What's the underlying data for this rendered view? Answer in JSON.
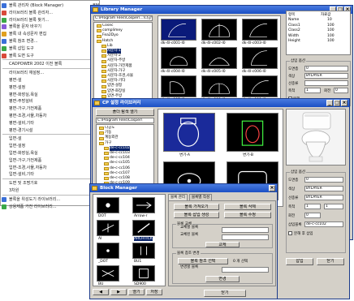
{
  "menu": {
    "items": [
      {
        "label": "블록 관리자 (Block Manager)",
        "shortcut": "BM",
        "icon": "block-icon",
        "color": "#3a6fd8"
      },
      {
        "label": "라이브러리 블록 관리자...",
        "shortcut": "LM",
        "icon": "library-icon",
        "color": "#d84a3a"
      },
      {
        "label": "라이브러리 블록 찾기...",
        "shortcut": "FB",
        "icon": "search-icon",
        "color": "#3aa848"
      },
      {
        "label": "블록을 문자 바꾸기",
        "shortcut": "BTM",
        "icon": "text-icon",
        "color": "#8a5ad8"
      },
      {
        "label": "블록 내 속성문자 편집",
        "shortcut": "",
        "icon": "edit-icon",
        "color": "#e0a020"
      },
      {
        "label": "블록 참조 변경...",
        "shortcut": "BRC",
        "icon": "swap-icon",
        "color": "#3a6fd8"
      },
      {
        "label": "블록 삽입 도구",
        "shortcut": "BMT",
        "icon": "insert-icon",
        "color": "#3aa848"
      },
      {
        "label": "블록 도면 도구",
        "shortcut": "",
        "icon": "tool-icon",
        "color": "#d84a3a"
      },
      {
        "label": "CADPOWER 2002 이전 블록",
        "shortcut": "",
        "icon": "",
        "color": ""
      },
      {
        "label": "라이브러리 재설정...",
        "shortcut": "",
        "icon": "",
        "color": ""
      },
      {
        "label": "평면-설",
        "shortcut": "",
        "icon": "",
        "color": ""
      },
      {
        "label": "평면-설정",
        "shortcut": "",
        "icon": "",
        "color": ""
      },
      {
        "label": "평면-화장실,욕실",
        "shortcut": "",
        "icon": "",
        "color": ""
      },
      {
        "label": "평면-주방설비",
        "shortcut": "",
        "icon": "",
        "color": ""
      },
      {
        "label": "평면-가구,가전제품",
        "shortcut": "",
        "icon": "",
        "color": ""
      },
      {
        "label": "평면-조경,사물,차동차",
        "shortcut": "",
        "icon": "",
        "color": ""
      },
      {
        "label": "평면-설비,기타",
        "shortcut": "",
        "icon": "",
        "color": ""
      },
      {
        "label": "평면-경기시설",
        "shortcut": "",
        "icon": "",
        "color": ""
      },
      {
        "label": "입면-설",
        "shortcut": "",
        "icon": "",
        "color": ""
      },
      {
        "label": "입면-설정",
        "shortcut": "",
        "icon": "",
        "color": ""
      },
      {
        "label": "입면-화장실,욕실",
        "shortcut": "",
        "icon": "",
        "color": ""
      },
      {
        "label": "입면-가구,가전제품",
        "shortcut": "",
        "icon": "",
        "color": ""
      },
      {
        "label": "입면-조경,사물,자동차",
        "shortcut": "",
        "icon": "",
        "color": ""
      },
      {
        "label": "입면-설비,기타",
        "shortcut": "",
        "icon": "",
        "color": ""
      },
      {
        "label": "도면 및 조명기호",
        "shortcut": "",
        "icon": "",
        "color": ""
      },
      {
        "label": "3차원",
        "shortcut": "",
        "icon": "",
        "color": ""
      },
      {
        "label": "블록을 위성도기 라이브러리...",
        "shortcut": "EB",
        "icon": "export-icon",
        "color": "#3a6fd8"
      },
      {
        "label": "상용제품 가전 라이브러리...",
        "shortcut": "ESS",
        "icon": "product-icon",
        "color": "#3aa848"
      }
    ]
  },
  "library_manager": {
    "title": "Library Manager",
    "path": "C:\\Program Files\\Cosper\\...\\다공\\",
    "tree": [
      "Cosec",
      "complimey",
      "Fea2Dyo",
      "Hatch",
      "Lib",
      "사문자-1",
      "사문자-2",
      "사문자-주방",
      "사문자-가전제품",
      "사문자-가구",
      "사문자-조경,사물",
      "사문자-기타",
      "입면-설정",
      "입면-화장실",
      "입면-주방",
      "입면-가구가전",
      "입면-조경",
      "입면-기타",
      "입면-경기시설"
    ],
    "thumbs": [
      "dk-4l-c001-l0",
      "dk-4l-c002-l0",
      "dk-4l-c003-l0",
      "dk-4l-c004-l0",
      "dk-4l-c005-l0",
      "dk-4l-c006-l0",
      "dk-4l-c007-l0",
      "dk-4l-c008-l0",
      "dk-4l-c009-l0"
    ],
    "info_header": [
      "항목",
      "자료값"
    ],
    "info_rows": [
      [
        "Name",
        "10"
      ],
      [
        "Class1",
        "100"
      ],
      [
        "Class2",
        "100"
      ],
      [
        "Width",
        "100"
      ],
      [
        "Height",
        "100"
      ]
    ],
    "insert_group": "삽입 옵션",
    "layer_label": "도면층",
    "layer_value": "0",
    "color_label": "색상",
    "color_value": "BYLAYER",
    "ltype_label": "선종류",
    "scale_label": "축척",
    "scale_x": "1",
    "rotate_label": "회전",
    "rotate_value": "0",
    "explode_label": "분해",
    "insert_button": "삽입",
    "close_button": "닫기"
  },
  "cp_dialog": {
    "title": "CP 설정 라이브러리",
    "select_button": "폴더 탐색 열기",
    "path": "C:\\Program Files\\Cosper\\",
    "tree": [
      "다공도",
      "기둥",
      "계동외관",
      "가구",
      "de-c-cc102",
      "de-c-cc103",
      "de-c-cc104",
      "de-c-cc105",
      "de-c-cc106",
      "de-c-cc107",
      "de-c-cc108",
      "de-c-cc109",
      "de-c-cc110",
      "de-c-cc111",
      "de-c-cc112"
    ],
    "thumb_labels": [
      "변기-A",
      "변기-B",
      "세면기",
      "욕조"
    ],
    "insert_group": "삽입 옵션",
    "layer_label": "도면층",
    "layer_value": "0",
    "color_label": "색상",
    "color_value": "BYLAYER",
    "ltype_label": "선종류",
    "ltype_value": "BYLAYER",
    "scale_label": "축척",
    "scale_x": "1",
    "scale_y": "1",
    "rotate_label": "회전",
    "rotate_value": "0",
    "name_label": "삽입블록",
    "name_value": "de-c-cc102",
    "explode_label": "분해 후 삽입",
    "insert_button": "삽입",
    "close_button": "닫기"
  },
  "block_manager": {
    "title": "Block Manager",
    "tabs": [
      "블록 관리",
      "블록별 작성"
    ],
    "blocks": [
      "DOT",
      "Arrow-r",
      "AI",
      "ARCHTICK",
      "_DOT",
      "BU1",
      "BU",
      "SD900"
    ],
    "selected_block": "ARCHTICK",
    "btn_get_block": "블록 가져오기",
    "btn_save_block": "블록 저장",
    "btn_delete_block": "블록 삭제",
    "btn_insert_block": "블록 삽입 생성",
    "btn_rename_block": "블록 수정",
    "replace_group": "블록 교체",
    "radio_replace": "교체할 블록",
    "radio_replace_new": "교체된 블록",
    "replace_button": "교체",
    "ref_group": "블록 참조 변경",
    "ref_button": "블록 참조 선택",
    "ref_count": "0 개 선택",
    "radio_change": "변경할 블록",
    "change_button": "변경",
    "small_buttons": [
      "◀",
      "▶",
      "열기",
      "저장"
    ],
    "close_button": "닫기"
  }
}
